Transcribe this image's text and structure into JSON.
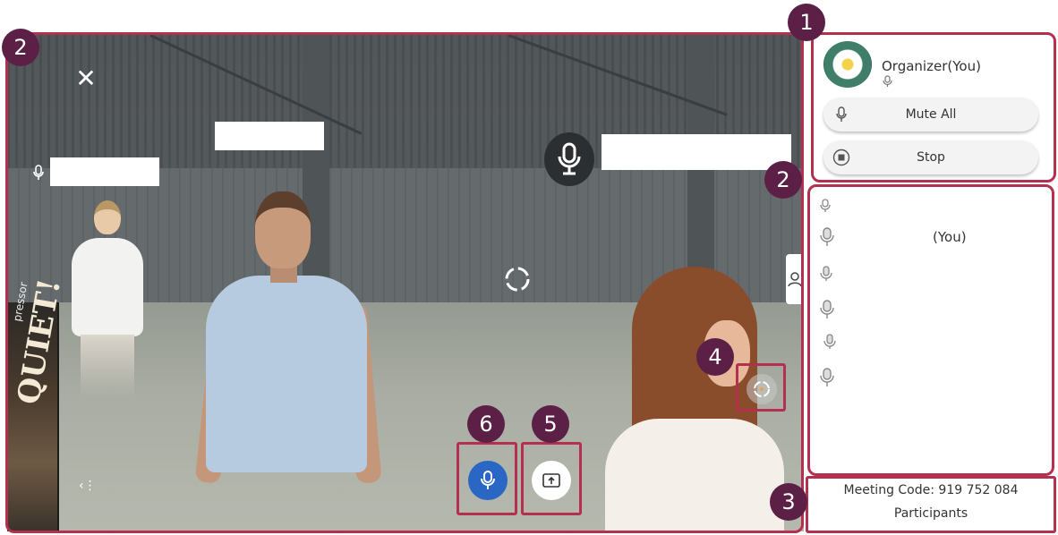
{
  "scene": {
    "poster_title": "pressor",
    "poster_text": "QUIET!"
  },
  "icons": {
    "close": "close-icon",
    "mic": "microphone-icon",
    "reticle": "reticle-icon",
    "participants_tab": "person-icon",
    "menu": "menu-icon",
    "recenter": "recenter-icon",
    "share": "share-screen-icon",
    "stop": "stop-icon"
  },
  "organizer": {
    "name": "Organizer(You)",
    "mute_all_label": "Mute All",
    "stop_label": "Stop"
  },
  "participants_list": {
    "you_label": "(You)"
  },
  "footer": {
    "meeting_code": "Meeting Code: 919 752 084",
    "participants_label": "Participants"
  },
  "annotations": {
    "badges": [
      "1",
      "2",
      "2",
      "3",
      "4",
      "5",
      "6"
    ]
  },
  "colors": {
    "highlight": "#b3304f",
    "badge": "#5c2046",
    "mic_button": "#2a66c3"
  }
}
